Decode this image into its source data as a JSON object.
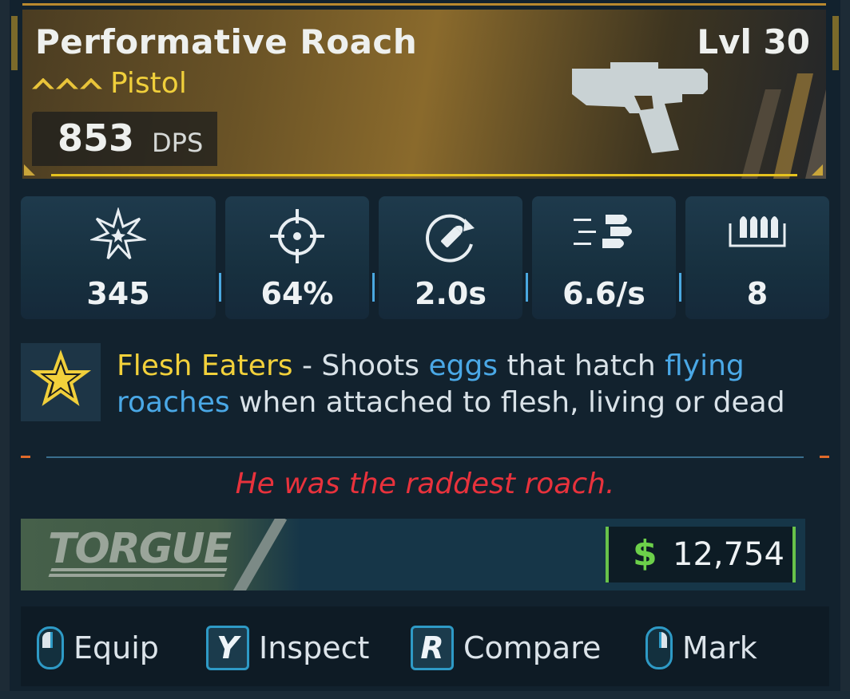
{
  "item": {
    "name": "Performative Roach",
    "level": "Lvl 30",
    "type": "Pistol",
    "dps_value": "853",
    "dps_unit": "DPS"
  },
  "stats": [
    {
      "icon": "damage-burst-icon",
      "value": "345"
    },
    {
      "icon": "accuracy-crosshair-icon",
      "value": "64%"
    },
    {
      "icon": "reload-icon",
      "value": "2.0s"
    },
    {
      "icon": "fire-rate-icon",
      "value": "6.6/s"
    },
    {
      "icon": "magazine-icon",
      "value": "8"
    }
  ],
  "perk": {
    "name": "Flesh Eaters",
    "dash": " - ",
    "t1": "Shoots ",
    "h1": "eggs",
    "t2": " that hatch ",
    "h2": "flying roaches",
    "t3": " when attached to flesh, living or dead"
  },
  "flavor": "He was the raddest roach.",
  "manufacturer": "TORGUE",
  "price": {
    "symbol": "$",
    "value": "12,754"
  },
  "actions": [
    {
      "icon": "mouse-left-icon",
      "label": "Equip"
    },
    {
      "key": "Y",
      "label": "Inspect"
    },
    {
      "key": "R",
      "label": "Compare"
    },
    {
      "icon": "mouse-right-icon",
      "label": "Mark"
    }
  ],
  "colors": {
    "rarity": "#f0cf3b",
    "highlight_blue": "#4aa8e6",
    "flavor_red": "#e8323c",
    "money_green": "#6cd04a"
  }
}
